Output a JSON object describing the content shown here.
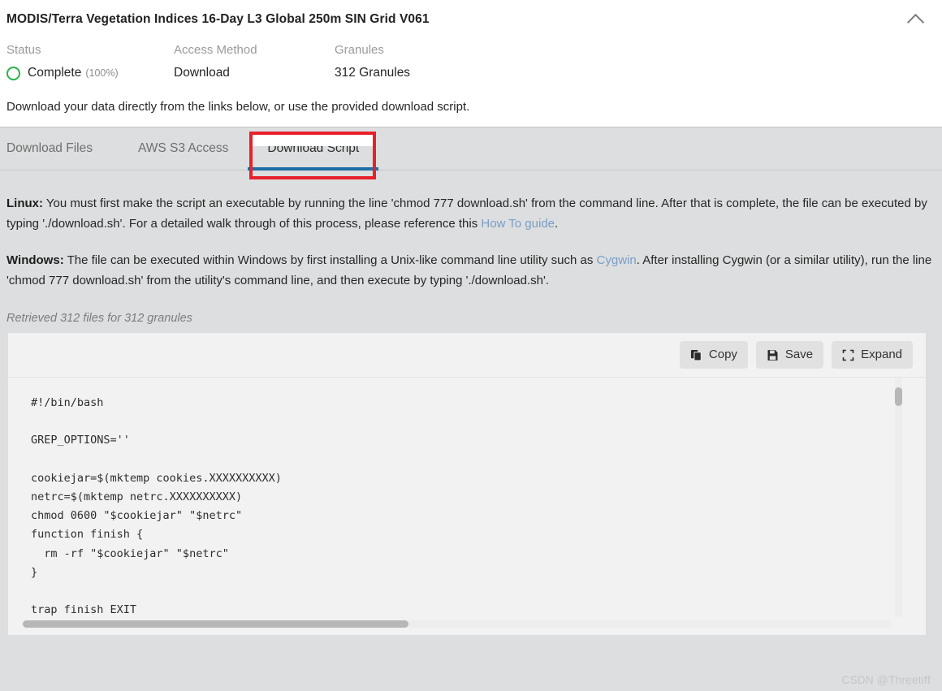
{
  "header": {
    "title": "MODIS/Terra Vegetation Indices 16-Day L3 Global 250m SIN Grid V061",
    "collapse_icon": "chevron-up-icon",
    "meta": [
      {
        "label": "Status",
        "value": "Complete",
        "extra": "(100%)"
      },
      {
        "label": "Access Method",
        "value": "Download",
        "extra": ""
      },
      {
        "label": "Granules",
        "value": "312 Granules",
        "extra": ""
      }
    ],
    "status_color": "#2bb24c",
    "intro": "Download your data directly from the links below, or use the provided download script."
  },
  "tabs": [
    {
      "label": "Download Files",
      "active": false
    },
    {
      "label": "AWS S3 Access",
      "active": false
    },
    {
      "label": "Download Script",
      "active": true
    }
  ],
  "annotation": {
    "color": "#e8202a",
    "target": "Download Script"
  },
  "instructions": {
    "linux": {
      "os": "Linux:",
      "part1": " You must first make the script an executable by running the line 'chmod 777 download.sh' from the command line. After that is complete, the file can be executed by typing './download.sh'. For a detailed walk through of this process, please reference this ",
      "link": "How To guide",
      "part2": "."
    },
    "windows": {
      "os": "Windows:",
      "part1": " The file can be executed within Windows by first installing a Unix-like command line utility such as ",
      "link": "Cygwin",
      "part2": ". After installing Cygwin (or a similar utility), run the line 'chmod 777 download.sh' from the utility's command line, and then execute by typing './download.sh'."
    },
    "link_color": "#7b9dc8"
  },
  "retrieved_text": "Retrieved 312 files for 312 granules",
  "code_panel": {
    "buttons": [
      {
        "label": "Copy",
        "icon": "copy-icon"
      },
      {
        "label": "Save",
        "icon": "floppy-disk-save-icon"
      },
      {
        "label": "Expand",
        "icon": "expand-icon"
      }
    ],
    "script": "#!/bin/bash\n\nGREP_OPTIONS=''\n\ncookiejar=$(mktemp cookies.XXXXXXXXXX)\nnetrc=$(mktemp netrc.XXXXXXXXXX)\nchmod 0600 \"$cookiejar\" \"$netrc\"\nfunction finish {\n  rm -rf \"$cookiejar\" \"$netrc\"\n}\n\ntrap finish EXIT\nWGETRC=\"$wgetrc\""
  },
  "watermark": "CSDN @Threetiff"
}
